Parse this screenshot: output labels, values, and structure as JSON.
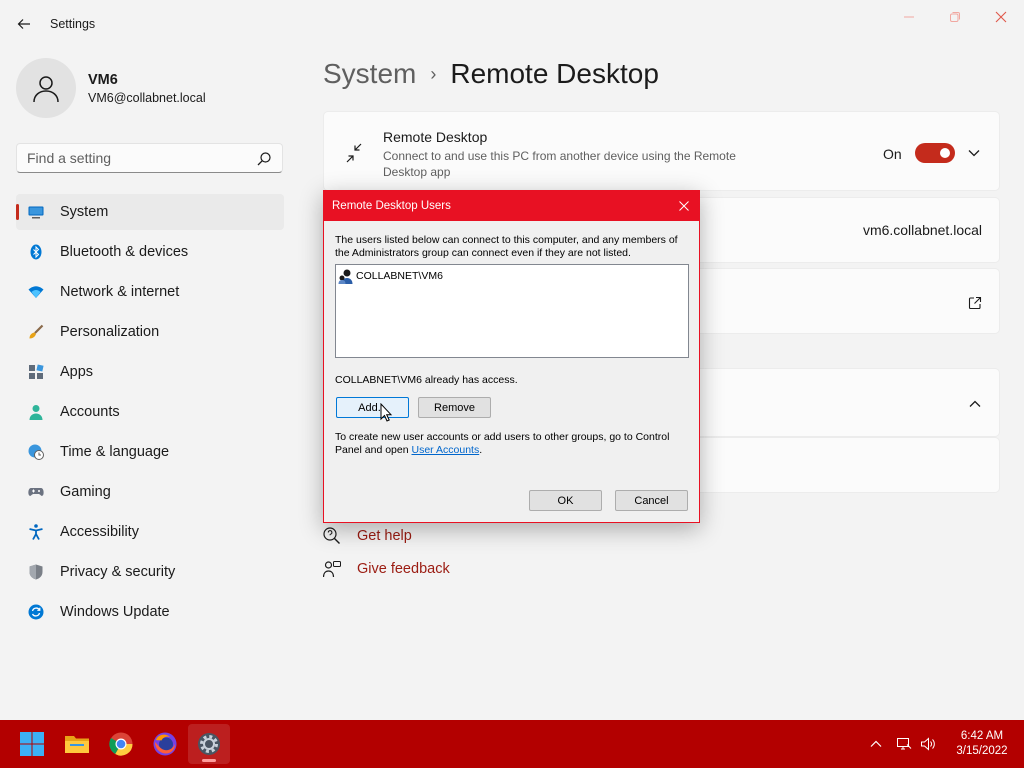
{
  "window": {
    "title": "Settings"
  },
  "user": {
    "name": "VM6",
    "email": "VM6@collabnet.local"
  },
  "search": {
    "placeholder": "Find a setting"
  },
  "nav": {
    "items": [
      {
        "label": "System",
        "icon": "system-icon",
        "selected": true
      },
      {
        "label": "Bluetooth & devices",
        "icon": "bluetooth-icon"
      },
      {
        "label": "Network & internet",
        "icon": "wifi-icon"
      },
      {
        "label": "Personalization",
        "icon": "brush-icon"
      },
      {
        "label": "Apps",
        "icon": "apps-icon"
      },
      {
        "label": "Accounts",
        "icon": "person-icon"
      },
      {
        "label": "Time & language",
        "icon": "globe-clock-icon"
      },
      {
        "label": "Gaming",
        "icon": "gamepad-icon"
      },
      {
        "label": "Accessibility",
        "icon": "accessibility-icon"
      },
      {
        "label": "Privacy & security",
        "icon": "shield-icon"
      },
      {
        "label": "Windows Update",
        "icon": "update-icon"
      }
    ]
  },
  "breadcrumb": {
    "parent": "System",
    "separator": "›",
    "current": "Remote Desktop"
  },
  "remote_desktop": {
    "title": "Remote Desktop",
    "description": "Connect to and use this PC from another device using the Remote Desktop app",
    "state": "On",
    "enabled": true
  },
  "pc_name": "vm6.collabnet.local",
  "help": {
    "get_help": "Get help",
    "give_feedback": "Give feedback"
  },
  "dialog": {
    "title": "Remote Desktop Users",
    "intro": "The users listed below can connect to this computer, and any members of the Administrators group can connect even if they are not listed.",
    "users": [
      "COLLABNET\\VM6"
    ],
    "access_status": "COLLABNET\\VM6 already has access.",
    "add_label": "Add...",
    "remove_label": "Remove",
    "create_text": "To create new user accounts or add users to other groups, go to Control Panel and open",
    "create_link": "User Accounts",
    "create_end": ".",
    "ok_label": "OK",
    "cancel_label": "Cancel"
  },
  "taskbar": {
    "apps": [
      "start-icon",
      "file-explorer-icon",
      "chrome-icon",
      "firefox-icon",
      "settings-icon"
    ],
    "active": "settings-icon",
    "time": "6:42 AM",
    "date": "3/15/2022"
  },
  "colors": {
    "accent": "#c42b1c",
    "dialog_title": "#e81123",
    "taskbar": "#b30000",
    "link": "#9b1c12"
  }
}
